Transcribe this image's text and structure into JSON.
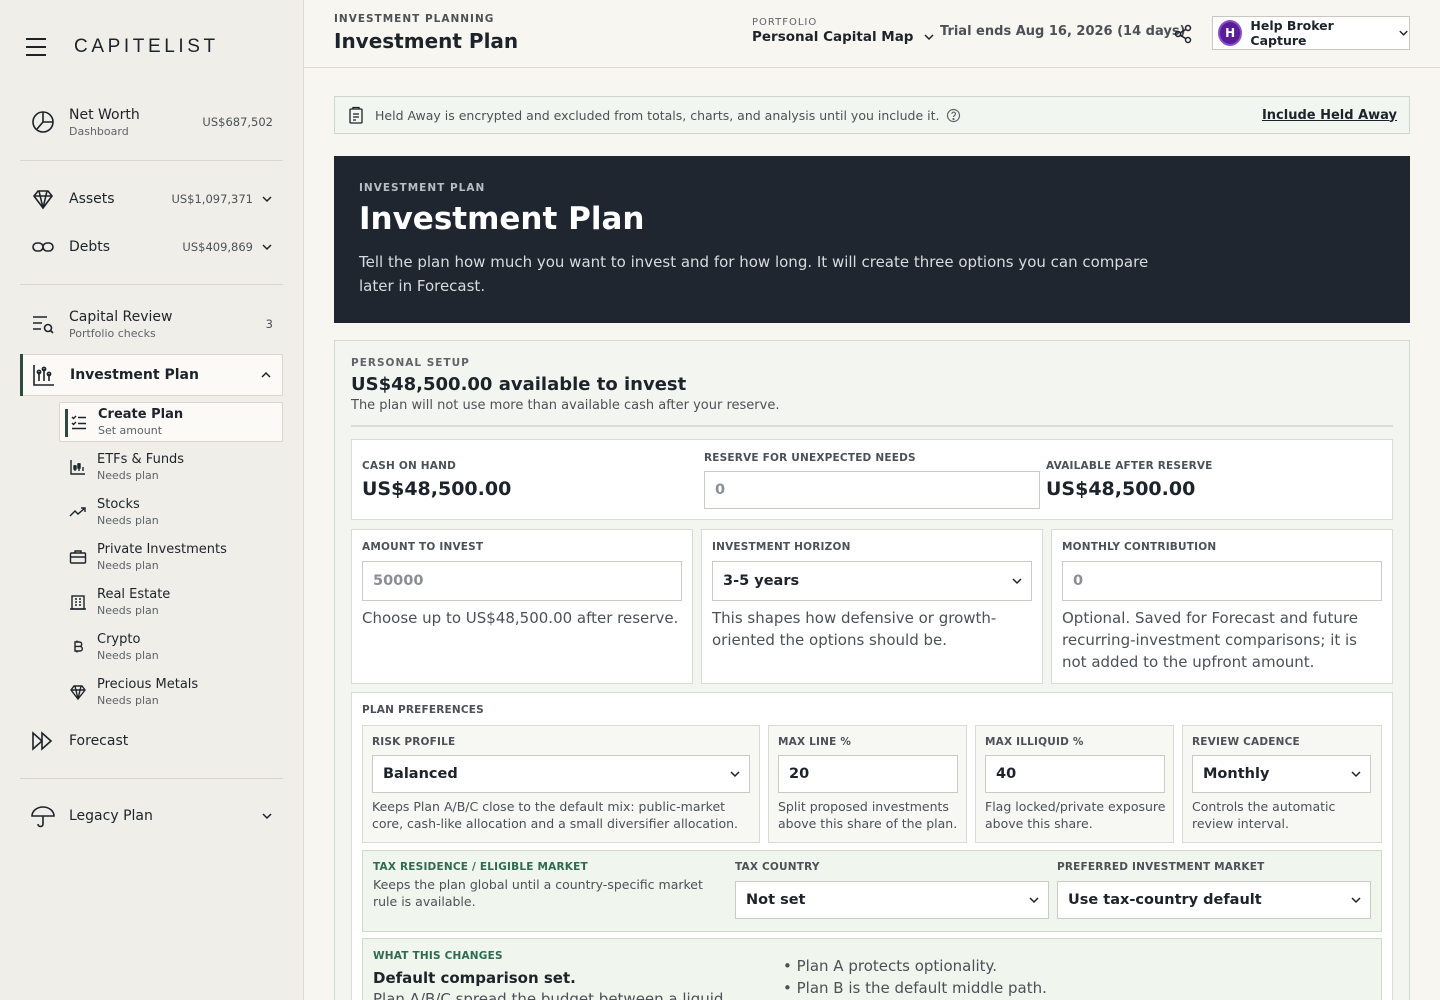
{
  "app": {
    "name": "CAPITELIST"
  },
  "sidebar": {
    "net_worth": {
      "label": "Net Worth",
      "sub": "Dashboard",
      "value": "US$687,502"
    },
    "assets": {
      "label": "Assets",
      "value": "US$1,097,371"
    },
    "debts": {
      "label": "Debts",
      "value": "US$409,869"
    },
    "capital_review": {
      "label": "Capital Review",
      "sub": "Portfolio checks",
      "badge": "3"
    },
    "investment_plan": {
      "label": "Investment Plan"
    },
    "sub_items": [
      {
        "label": "Create Plan",
        "sub": "Set amount"
      },
      {
        "label": "ETFs & Funds",
        "sub": "Needs plan"
      },
      {
        "label": "Stocks",
        "sub": "Needs plan"
      },
      {
        "label": "Private Investments",
        "sub": "Needs plan"
      },
      {
        "label": "Real Estate",
        "sub": "Needs plan"
      },
      {
        "label": "Crypto",
        "sub": "Needs plan"
      },
      {
        "label": "Precious Metals",
        "sub": "Needs plan"
      }
    ],
    "forecast": {
      "label": "Forecast"
    },
    "legacy_plan": {
      "label": "Legacy Plan"
    }
  },
  "header": {
    "eyebrow": "INVESTMENT PLANNING",
    "title": "Investment Plan",
    "portfolio_label": "PORTFOLIO",
    "portfolio_value": "Personal Capital Map",
    "trial": "Trial ends Aug 16, 2026 (14 days)",
    "user_initial": "H",
    "user_name": "Help Broker Capture"
  },
  "notice": {
    "text": "Held Away is encrypted and excluded from totals, charts, and analysis until you include it.",
    "link": "Include Held Away"
  },
  "hero": {
    "eyebrow": "INVESTMENT PLAN",
    "title": "Investment Plan",
    "description": "Tell the plan how much you want to invest and for how long. It will create three options you can compare later in Forecast."
  },
  "setup": {
    "eyebrow": "PERSONAL SETUP",
    "title": "US$48,500.00 available to invest",
    "subtitle": "The plan will not use more than available cash after your reserve.",
    "cash_on_hand": {
      "label": "CASH ON HAND",
      "value": "US$48,500.00"
    },
    "reserve": {
      "label": "RESERVE FOR UNEXPECTED NEEDS",
      "placeholder": "0"
    },
    "available": {
      "label": "AVAILABLE AFTER RESERVE",
      "value": "US$48,500.00"
    },
    "amount": {
      "label": "AMOUNT TO INVEST",
      "placeholder": "50000",
      "help": "Choose up to US$48,500.00 after reserve."
    },
    "horizon": {
      "label": "INVESTMENT HORIZON",
      "value": "3-5 years",
      "help": "This shapes how defensive or growth-oriented the options should be."
    },
    "monthly": {
      "label": "MONTHLY CONTRIBUTION",
      "placeholder": "0",
      "help": "Optional. Saved for Forecast and future recurring-investment comparisons; it is not added to the upfront amount."
    }
  },
  "preferences": {
    "title": "PLAN PREFERENCES",
    "risk": {
      "label": "RISK PROFILE",
      "value": "Balanced",
      "help": "Keeps Plan A/B/C close to the default mix: public-market core, cash-like allocation and a small diversifier allocation."
    },
    "max_line": {
      "label": "MAX LINE %",
      "value": "20",
      "help": "Split proposed investments above this share of the plan."
    },
    "max_illiquid": {
      "label": "MAX ILLIQUID %",
      "value": "40",
      "help": "Flag locked/private exposure above this share."
    },
    "cadence": {
      "label": "REVIEW CADENCE",
      "value": "Monthly",
      "help": "Controls the automatic review interval."
    },
    "tax": {
      "label": "TAX RESIDENCE / ELIGIBLE MARKET",
      "help": "Keeps the plan global until a country-specific market rule is available.",
      "country_label": "TAX COUNTRY",
      "country_value": "Not set",
      "market_label": "PREFERRED INVESTMENT MARKET",
      "market_value": "Use tax-country default"
    },
    "what": {
      "label": "WHAT THIS CHANGES",
      "title": "Default comparison set.",
      "desc": "Plan A/B/C spread the budget between a liquid",
      "bullets": [
        "Plan A protects optionality.",
        "Plan B is the default middle path."
      ]
    }
  }
}
